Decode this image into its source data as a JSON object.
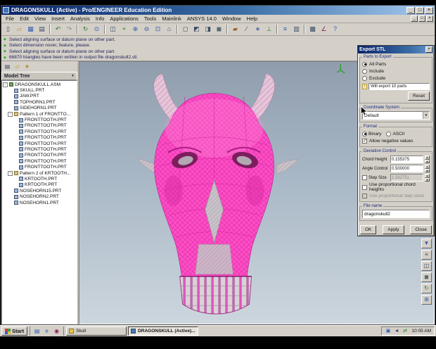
{
  "colors": {
    "chrome": "#d4d0c8",
    "titlebar_start": "#0a246a",
    "titlebar_end": "#a6caf0",
    "model_pink": "#ff4ec5",
    "viewport_top": "#8f9dac",
    "viewport_bottom": "#cdd6dd",
    "status_green": "#2faa2f"
  },
  "icons": {
    "chevron_down": "▼",
    "close": "×",
    "minimize": "_",
    "maximize": "□",
    "spin_up": "▲",
    "spin_down": "▼",
    "diamond_marker": "◆",
    "info": "i"
  },
  "window": {
    "title": "DRAGONSKULL (Active) - Pro/ENGINEER Education Edition"
  },
  "menubar": {
    "items": [
      "File",
      "Edit",
      "View",
      "Insert",
      "Analysis",
      "Info",
      "Applications",
      "Tools",
      "Mainlink",
      "ANSYS 14.0",
      "Window",
      "Help"
    ]
  },
  "toolbar": {
    "icons": [
      {
        "name": "new-file",
        "glyph": "▯",
        "color": "#3b4a66"
      },
      {
        "name": "open-file",
        "glyph": "▱",
        "color": "#c08a1a"
      },
      {
        "name": "save-file",
        "glyph": "▦",
        "color": "#2f5bb0"
      },
      {
        "name": "print",
        "glyph": "▤",
        "color": "#3b4a66"
      },
      {
        "sep": true
      },
      {
        "name": "undo",
        "glyph": "↶",
        "color": "#2f7d2f"
      },
      {
        "name": "redo",
        "glyph": "↷",
        "color": "#8a8a8a"
      },
      {
        "sep": true
      },
      {
        "name": "regenerate",
        "glyph": "↻",
        "color": "#2f7d2f"
      },
      {
        "name": "find",
        "glyph": "⊙",
        "color": "#2f5bb0"
      },
      {
        "sep": true
      },
      {
        "name": "repaint",
        "glyph": "◫",
        "color": "#3b4a66"
      },
      {
        "name": "spin-center",
        "glyph": "+",
        "color": "#2f7d2f"
      },
      {
        "name": "zoom-in",
        "glyph": "⊕",
        "color": "#2f5bb0"
      },
      {
        "name": "zoom-out",
        "glyph": "⊖",
        "color": "#2f5bb0"
      },
      {
        "name": "refit",
        "glyph": "⊡",
        "color": "#2f5bb0"
      },
      {
        "name": "named-views",
        "glyph": "⌂",
        "color": "#3b4a66"
      },
      {
        "sep": true
      },
      {
        "name": "wireframe-display",
        "glyph": "◻",
        "color": "#3b4a66"
      },
      {
        "name": "hidden-line-display",
        "glyph": "◩",
        "color": "#3b4a66"
      },
      {
        "name": "no-hidden-display",
        "glyph": "◨",
        "color": "#3b4a66"
      },
      {
        "name": "shaded-display",
        "glyph": "◼",
        "color": "#5a6a7a"
      },
      {
        "sep": true
      },
      {
        "name": "datum-planes-toggle",
        "glyph": "▰",
        "color": "#9a5d2f"
      },
      {
        "name": "datum-axes-toggle",
        "glyph": "∕",
        "color": "#8b2252"
      },
      {
        "name": "datum-points-toggle",
        "glyph": "∗",
        "color": "#2f5bb0"
      },
      {
        "name": "csys-toggle",
        "glyph": "⊥",
        "color": "#2f7d2f"
      },
      {
        "sep": true
      },
      {
        "name": "model-tree-toggle",
        "glyph": "≡",
        "color": "#2f5bb0"
      },
      {
        "name": "layers",
        "glyph": "▥",
        "color": "#3b4a66"
      },
      {
        "sep": true
      },
      {
        "name": "mesh-tool",
        "glyph": "▩",
        "color": "#3b4a66"
      },
      {
        "name": "analysis-tool",
        "glyph": "∠",
        "color": "#8b2252"
      },
      {
        "name": "context-help",
        "glyph": "?",
        "color": "#2f5bb0"
      }
    ]
  },
  "messages": {
    "items": [
      {
        "text": "Select aligning surface or datum plane on other part."
      },
      {
        "text": "Select dimension nover, feature, please."
      },
      {
        "text": "Select aligning surface or datum plane on other part."
      },
      {
        "text": "66870 triangles have been written in output file dragonskull2.stl."
      }
    ]
  },
  "model_tree": {
    "header": "Model Tree",
    "panel_icons": [
      {
        "name": "tree-columns",
        "glyph": "▤",
        "color": "#3b4a66"
      },
      {
        "name": "folder-browser",
        "glyph": "▱",
        "color": "#c08a1a"
      },
      {
        "name": "favorites",
        "glyph": "★",
        "color": "#b08c2f"
      }
    ],
    "items": [
      {
        "label": "DRAGONSKULL.ASM",
        "level": 0,
        "type": "asm",
        "exp": "-"
      },
      {
        "label": "SKULL.PRT",
        "level": 1,
        "type": "prt"
      },
      {
        "label": "JAW.PRT",
        "level": 1,
        "type": "prt"
      },
      {
        "label": "TOPHORN1.PRT",
        "level": 1,
        "type": "prt"
      },
      {
        "label": "SIDEHORN1.PRT",
        "level": 1,
        "type": "prt"
      },
      {
        "label": "Pattern 1 of FRONTTO...",
        "level": 1,
        "type": "pat",
        "exp": "-"
      },
      {
        "label": "FRONTTOOTH.PRT",
        "level": 2,
        "type": "prt"
      },
      {
        "label": "FRONTTOOTH.PRT",
        "level": 2,
        "type": "prt"
      },
      {
        "label": "FRONTTOOTH.PRT",
        "level": 2,
        "type": "prt"
      },
      {
        "label": "FRONTTOOTH.PRT",
        "level": 2,
        "type": "prt"
      },
      {
        "label": "FRONTTOOTH.PRT",
        "level": 2,
        "type": "prt"
      },
      {
        "label": "FRONTTOOTH.PRT",
        "level": 2,
        "type": "prt"
      },
      {
        "label": "FRONTTOOTH.PRT",
        "level": 2,
        "type": "prt"
      },
      {
        "label": "FRONTTOOTH.PRT",
        "level": 2,
        "type": "prt"
      },
      {
        "label": "FRONTTOOTH.PRT",
        "level": 2,
        "type": "prt"
      },
      {
        "label": "Pattern 2 of KRTOOTH...",
        "level": 1,
        "type": "pat",
        "exp": "-"
      },
      {
        "label": "KRTOOTH.PRT",
        "level": 2,
        "type": "prt"
      },
      {
        "label": "KRTOOTH.PRT",
        "level": 2,
        "type": "prt"
      },
      {
        "label": "NOSEHORN15.PRT",
        "level": 1,
        "type": "prt"
      },
      {
        "label": "NOSEHORN2.PRT",
        "level": 1,
        "type": "prt"
      },
      {
        "label": "NOSEHORN1.PRT",
        "level": 1,
        "type": "prt"
      }
    ]
  },
  "side_toolbar": {
    "icons": [
      {
        "name": "saved-view-list",
        "glyph": "▼",
        "color": "#2f5bb0"
      },
      {
        "name": "layer-display",
        "glyph": "≡",
        "color": "#3b4a66"
      },
      {
        "name": "view-manager",
        "glyph": "◫",
        "color": "#3b4a66"
      },
      {
        "name": "render-mode",
        "glyph": "◼",
        "color": "#5a6a7a"
      },
      {
        "name": "spin-mode",
        "glyph": "↻",
        "color": "#2f7d2f"
      },
      {
        "name": "zoom-region",
        "glyph": "⊞",
        "color": "#2f5bb0"
      }
    ]
  },
  "export_dialog": {
    "title": "Export STL",
    "parts": {
      "legend": "Parts to Export",
      "options": [
        {
          "label": "All Parts",
          "selected": true
        },
        {
          "label": "Include",
          "selected": false
        },
        {
          "label": "Exclude",
          "selected": false
        }
      ],
      "info": "Will export 10 parts",
      "reset": "Reset"
    },
    "coordinate_system": {
      "legend": "Coordinate System",
      "value": "Default"
    },
    "format": {
      "legend": "Format",
      "options": [
        {
          "label": "Binary",
          "selected": true
        },
        {
          "label": "ASCII",
          "selected": false
        }
      ],
      "allow_negative": {
        "label": "Allow negative values",
        "checked": true
      }
    },
    "deviation": {
      "legend": "Deviation Control",
      "chord_height": {
        "label": "Chord Height",
        "value": "0.155375"
      },
      "angle_control": {
        "label": "Angle Control",
        "value": "0.500000"
      },
      "step_size": {
        "label": "Step Size",
        "value": "1.582751",
        "checked": false,
        "enabled": false
      },
      "proportional_chord": {
        "label": "Use proportional chord heights",
        "checked": false
      },
      "proportional_step": {
        "label": "Use proportional step sizes",
        "checked": false,
        "enabled": false
      }
    },
    "file_name": {
      "legend": "File name",
      "value": "dragonskull2"
    },
    "buttons": {
      "ok": "OK",
      "apply": "Apply",
      "close": "Close"
    }
  },
  "taskbar": {
    "start": "Start",
    "quick_launch": [
      {
        "name": "show-desktop",
        "glyph": "▤",
        "color": "#2f5bb0"
      },
      {
        "name": "internet-explorer",
        "glyph": "e",
        "color": "#2f5bb0"
      },
      {
        "name": "media-player",
        "glyph": "◉",
        "color": "#8b2252"
      }
    ],
    "tasks": [
      {
        "label": "Skull",
        "active": false,
        "icon_color": "#e8c84a"
      },
      {
        "label": "DRAGONSKULL (Active)...",
        "active": true,
        "icon_color": "#4a7ab5"
      }
    ],
    "tray": {
      "icons": [
        {
          "name": "display-settings",
          "glyph": "▣",
          "color": "#2f5bb0"
        },
        {
          "name": "volume",
          "glyph": "◄",
          "color": "#3b4a66"
        },
        {
          "name": "network",
          "glyph": "⇄",
          "color": "#2f7d2f"
        }
      ],
      "clock": "10:05 AM"
    }
  }
}
